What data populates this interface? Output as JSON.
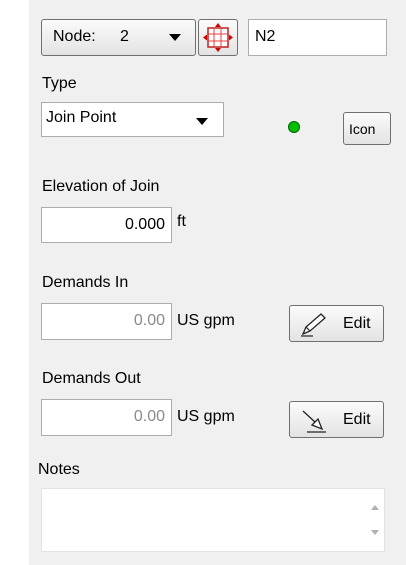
{
  "node": {
    "selector_label": "Node:",
    "selector_value": "2",
    "name_value": "N2",
    "pick_icon": "crosshair-icon"
  },
  "type": {
    "label": "Type",
    "value": "Join Point",
    "status_color": "#00c000",
    "icon_button_label": "Icon"
  },
  "elevation": {
    "label": "Elevation of Join",
    "value": "0.000",
    "unit": "ft"
  },
  "demands_in": {
    "label": "Demands In",
    "value": "0.00",
    "unit": "US gpm",
    "edit_label": "Edit",
    "edit_icon": "pencil-icon"
  },
  "demands_out": {
    "label": "Demands Out",
    "value": "0.00",
    "unit": "US gpm",
    "edit_label": "Edit",
    "edit_icon": "arrow-out-icon"
  },
  "notes": {
    "label": "Notes",
    "value": ""
  }
}
